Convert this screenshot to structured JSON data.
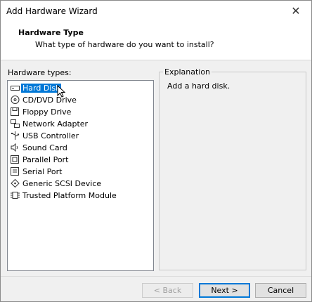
{
  "window": {
    "title": "Add Hardware Wizard",
    "close_glyph": "✕"
  },
  "header": {
    "title": "Hardware Type",
    "subtitle": "What type of hardware do you want to install?"
  },
  "hardware": {
    "label": "Hardware types:",
    "selected": "Hard Disk",
    "items": [
      {
        "label": "Hard Disk",
        "icon": "hard-disk-icon"
      },
      {
        "label": "CD/DVD Drive",
        "icon": "cd-dvd-icon"
      },
      {
        "label": "Floppy Drive",
        "icon": "floppy-icon"
      },
      {
        "label": "Network Adapter",
        "icon": "network-icon"
      },
      {
        "label": "USB Controller",
        "icon": "usb-icon"
      },
      {
        "label": "Sound Card",
        "icon": "speaker-icon"
      },
      {
        "label": "Parallel Port",
        "icon": "parallel-port-icon"
      },
      {
        "label": "Serial Port",
        "icon": "serial-port-icon"
      },
      {
        "label": "Generic SCSI Device",
        "icon": "scsi-icon"
      },
      {
        "label": "Trusted Platform Module",
        "icon": "tpm-icon"
      }
    ]
  },
  "explanation": {
    "legend": "Explanation",
    "text": "Add a hard disk."
  },
  "buttons": {
    "back": "< Back",
    "next": "Next >",
    "cancel": "Cancel"
  },
  "colors": {
    "selection": "#0078d7"
  }
}
